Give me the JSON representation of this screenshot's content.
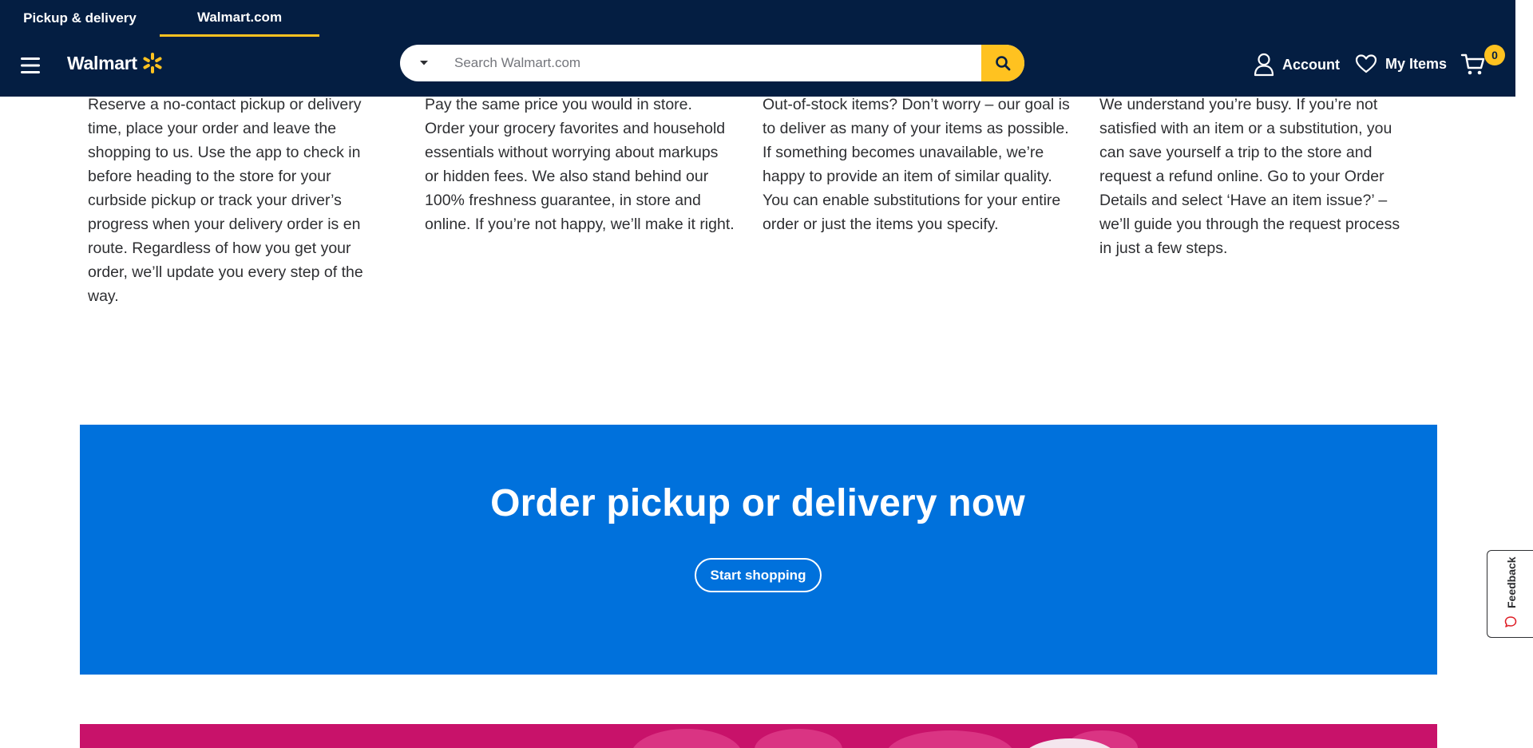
{
  "header": {
    "tabs": [
      {
        "label": "Pickup & delivery"
      },
      {
        "label": "Walmart.com"
      }
    ],
    "logo_text": "Walmart",
    "search": {
      "placeholder": "Search Walmart.com",
      "value": ""
    },
    "account_label": "Account",
    "my_items_label": "My Items",
    "cart_count": "0"
  },
  "columns": [
    {
      "text": "Reserve a no-contact pickup or delivery time, place your order and leave the shopping to us. Use the app to check in before heading to the store for your curbside pickup or track your driver’s progress when your delivery order is en route. Regardless of how you get your order, we’ll update you every step of the way."
    },
    {
      "text": "Pay the same price you would in store. Order your grocery favorites and household essentials without worrying about markups or hidden fees. We also stand behind our 100% freshness guarantee, in store and online. If you’re not happy, we’ll make it right."
    },
    {
      "text": "Out-of-stock items? Don’t worry – our goal is to deliver as many of your items as possible. If something becomes unavailable, we’re happy to provide an item of similar quality. You can enable substitutions for your entire order or just the items you specify."
    },
    {
      "text": "We understand you’re busy. If you’re not satisfied with an item or a substitution, you can save yourself a trip to the store and request a refund online. Go to your Order Details and select ‘Have an item issue?’ – we’ll guide you through the request process in just a few steps."
    }
  ],
  "promo": {
    "title": "Order pickup or delivery now",
    "button_label": "Start shopping"
  },
  "feedback": {
    "label": "Feedback"
  },
  "colors": {
    "header_bg": "#041e42",
    "accent_yellow": "#ffc220",
    "promo_blue": "#0071dc",
    "pink_banner": "#c8126a",
    "body_text": "#2e2f32"
  },
  "icons": {
    "menu": "hamburger-icon",
    "spark": "spark-logo-icon",
    "search": "search-icon",
    "dropdown": "chevron-down-icon",
    "account": "user-icon",
    "my_items": "heart-icon",
    "cart": "cart-icon",
    "feedback": "chat-bubble-icon"
  }
}
